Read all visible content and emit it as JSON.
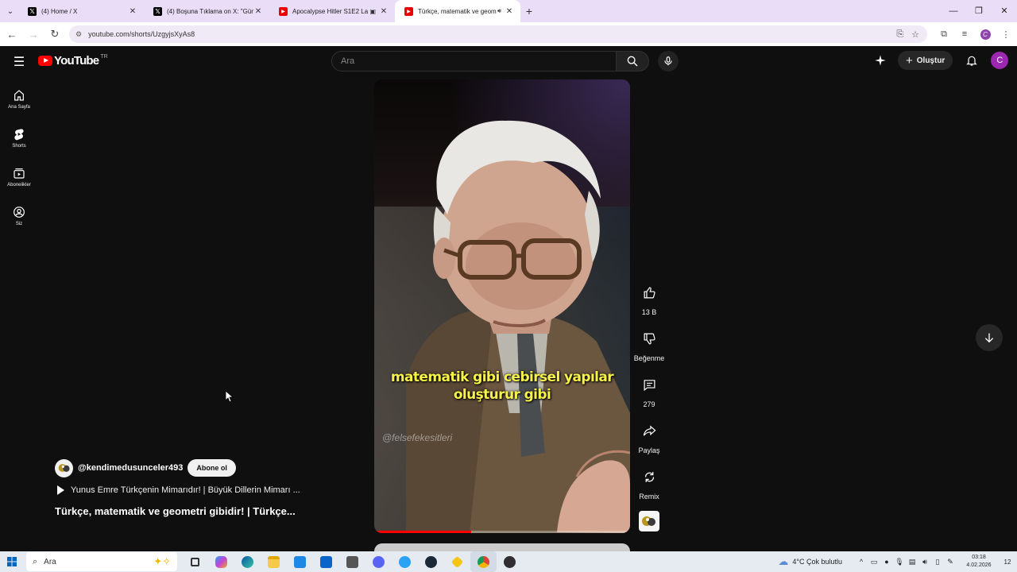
{
  "browser": {
    "tabs": [
      {
        "icon": "x-logo-icon",
        "title": "(4) Home / X",
        "active": false
      },
      {
        "icon": "x-logo-icon",
        "title": "(4) Boşuna Tıklama on X: \"Güne",
        "active": false
      },
      {
        "icon": "youtube-favicon-icon",
        "title": "Apocalypse Hitler S1E2 La 1",
        "active": false
      },
      {
        "icon": "youtube-favicon-icon",
        "title": "Türkçe, matematik ve geom",
        "active": true
      }
    ],
    "url": "youtube.com/shorts/UzgyjsXyAs8"
  },
  "header": {
    "logo_text": "YouTube",
    "country_code": "TR",
    "search_placeholder": "Ara",
    "create_label": "Oluştur",
    "avatar_letter": "C"
  },
  "sidebar": {
    "items": [
      {
        "label": "Ana Sayfa",
        "icon": "home-icon"
      },
      {
        "label": "Shorts",
        "icon": "shorts-icon"
      },
      {
        "label": "Abonelikler",
        "icon": "subscriptions-icon"
      },
      {
        "label": "Siz",
        "icon": "you-icon"
      }
    ]
  },
  "video": {
    "subtitle_line1": "matematik gibi cebirsel yapılar",
    "subtitle_line2": "oluşturur gibi",
    "watermark": "@felsefekesitleri",
    "progress_fraction": 0.38
  },
  "actions": {
    "like_count": "13 B",
    "dislike_label": "Beğenme",
    "comment_count": "279",
    "share_label": "Paylaş",
    "remix_label": "Remix"
  },
  "meta": {
    "channel": "@kendimedusunceler493",
    "subscribe_label": "Abone ol",
    "related_title": "Yunus Emre Türkçenin Mimarıdır! | Büyük Dillerin Mimarı ...",
    "title": "Türkçe, matematik ve geometri gibidir! | Türkçe..."
  },
  "taskbar": {
    "search_placeholder": "Ara",
    "weather": "4°C  Çok bulutlu",
    "time": "03:18",
    "date": "4.02.2026",
    "notif_count": "12"
  }
}
